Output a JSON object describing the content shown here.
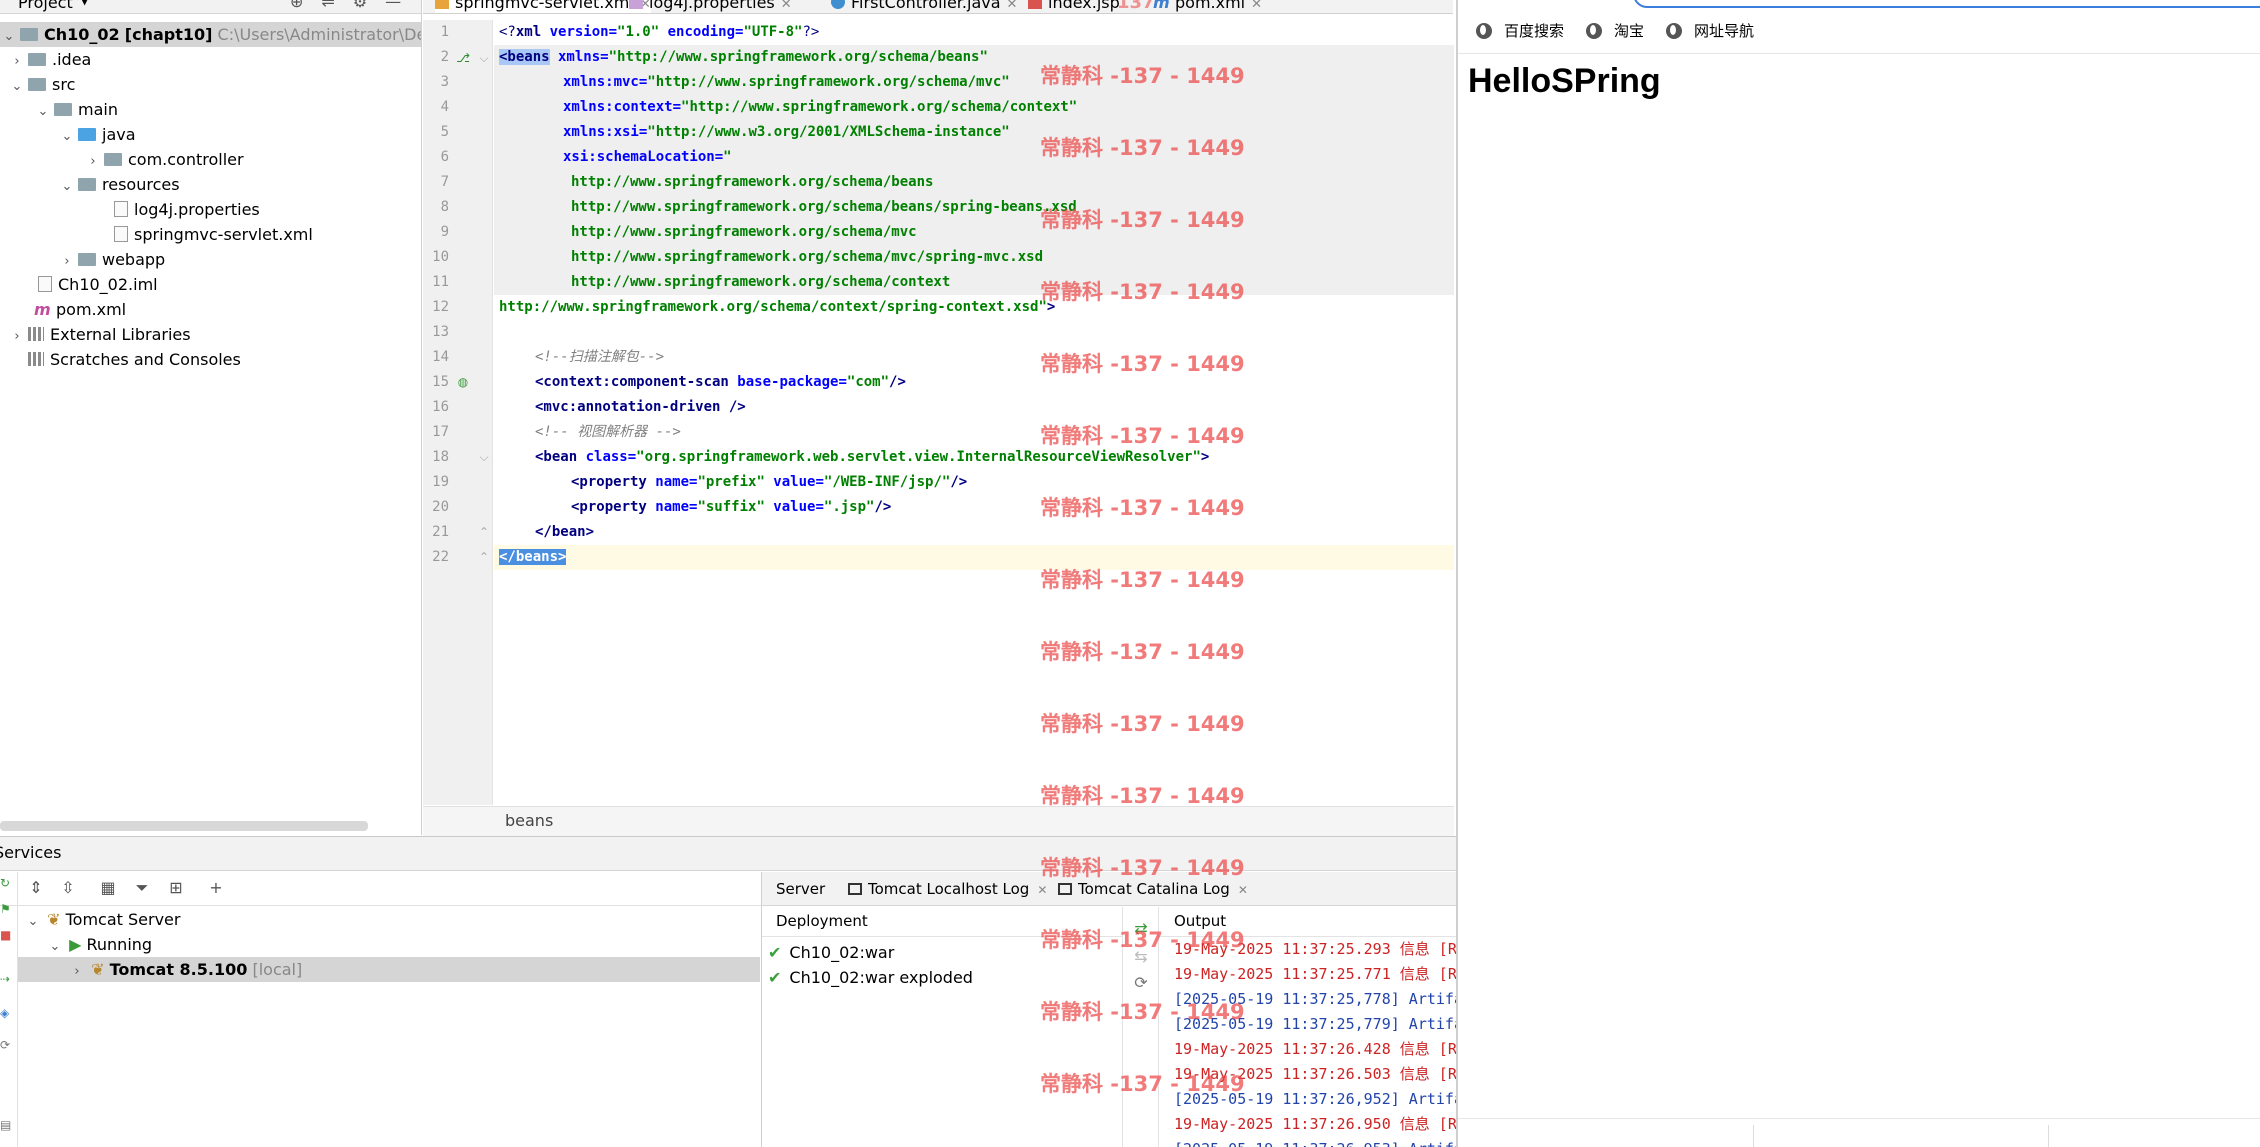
{
  "project": {
    "title": "Project",
    "root_name": "Ch10_02",
    "root_module": "[chapt10]",
    "root_path": "C:\\Users\\Administrator\\Desktop\\",
    "items": {
      "idea": ".idea",
      "src": "src",
      "main": "main",
      "java": "java",
      "com_controller": "com.controller",
      "resources": "resources",
      "log4j": "log4j.properties",
      "springmvc": "springmvc-servlet.xml",
      "webapp": "webapp",
      "iml": "Ch10_02.iml",
      "pom": "pom.xml",
      "external": "External Libraries",
      "scratches": "Scratches and Consoles"
    }
  },
  "editor": {
    "tabs": {
      "t1": "springmvc-servlet.xml",
      "t2": "log4j.properties",
      "t3": "FirstController.java",
      "t4": "index.jsp",
      "t5": "pom.xml"
    },
    "line_numbers": [
      "1",
      "2",
      "3",
      "4",
      "5",
      "6",
      "7",
      "8",
      "9",
      "10",
      "11",
      "12",
      "13",
      "14",
      "15",
      "16",
      "17",
      "18",
      "19",
      "20",
      "21",
      "22"
    ],
    "code": {
      "l1_open": "<?",
      "l1_tag": "xml",
      "l1_a1": " version=",
      "l1_v1": "\"1.0\"",
      "l1_a2": " encoding=",
      "l1_v2": "\"UTF-8\"",
      "l1_close": "?>",
      "l2_tag": "<beans",
      "l2_attr": " xmlns=",
      "l2_val": "\"http://www.springframework.org/schema/beans\"",
      "l3_attr": "xmlns:mvc=",
      "l3_val": "\"http://www.springframework.org/schema/mvc\"",
      "l4_attr": "xmlns:context=",
      "l4_val": "\"http://www.springframework.org/schema/context\"",
      "l5_attr": "xmlns:xsi=",
      "l5_val": "\"http://www.w3.org/2001/XMLSchema-instance\"",
      "l6_attr": "xsi:schemaLocation=",
      "l6_val": "\"",
      "l7": "http://www.springframework.org/schema/beans",
      "l8": "http://www.springframework.org/schema/beans/spring-beans.xsd",
      "l9": "http://www.springframework.org/schema/mvc",
      "l10": "http://www.springframework.org/schema/mvc/spring-mvc.xsd",
      "l11": "http://www.springframework.org/schema/context",
      "l12_val": "http://www.springframework.org/schema/context/spring-context.xsd\"",
      "l12_close": ">",
      "l14": "<!--扫描注解包-->",
      "l15_tag": "<context:component-scan",
      "l15_attr": " base-package=",
      "l15_val": "\"com\"",
      "l15_close": "/>",
      "l16_tag": "<mvc:annotation-driven",
      "l16_close": " />",
      "l17": "<!-- 视图解析器 -->",
      "l18_tag": "<bean",
      "l18_attr": " class=",
      "l18_val": "\"org.springframework.web.servlet.view.InternalResourceViewResolver\"",
      "l18_close": ">",
      "l19_tag": "<property",
      "l19_a1": " name=",
      "l19_v1": "\"prefix\"",
      "l19_a2": " value=",
      "l19_v2": "\"/WEB-INF/jsp/\"",
      "l19_close": "/>",
      "l20_tag": "<property",
      "l20_a1": " name=",
      "l20_v1": "\"suffix\"",
      "l20_a2": " value=",
      "l20_v2": "\".jsp\"",
      "l20_close": "/>",
      "l21": "</bean>",
      "l22": "</beans>"
    },
    "breadcrumb": "beans"
  },
  "services": {
    "title": "Services",
    "tree": {
      "tomcat_server": "Tomcat Server",
      "running": "Running",
      "instance": "Tomcat 8.5.100",
      "instance_suffix": "[local]"
    },
    "tabs": {
      "server": "Server",
      "localhost_log": "Tomcat Localhost Log",
      "catalina_log": "Tomcat Catalina Log"
    },
    "deployment_header": "Deployment",
    "deployments": [
      "Ch10_02:war",
      "Ch10_02:war exploded"
    ],
    "output_header": "Output",
    "log_lines": [
      "19-May-2025 11:37:25.293 信息 [R",
      "19-May-2025 11:37:25.771 信息 [R",
      "[2025-05-19 11:37:25,778] Artifa",
      "[2025-05-19 11:37:25,779] Artifa",
      "19-May-2025 11:37:26.428 信息 [R",
      "19-May-2025 11:37:26.503 信息 [R",
      "[2025-05-19 11:37:26,952] Artifa",
      "19-May-2025 11:37:26.950 信息 [R",
      "[2025-05-19 11:37:26,953] Artifa"
    ]
  },
  "browser": {
    "bookmarks": [
      "百度搜索",
      "淘宝",
      "网址导航"
    ],
    "page_heading": "HelloSPring"
  },
  "watermark": {
    "text": "常静科 -137 - 1449",
    "fragment": "137"
  },
  "colors": {
    "tag": "#000080",
    "attribute": "#0000ff",
    "string": "#008000",
    "comment": "#808080",
    "watermark": "#eb4646",
    "selection": "#a9c8f5"
  }
}
